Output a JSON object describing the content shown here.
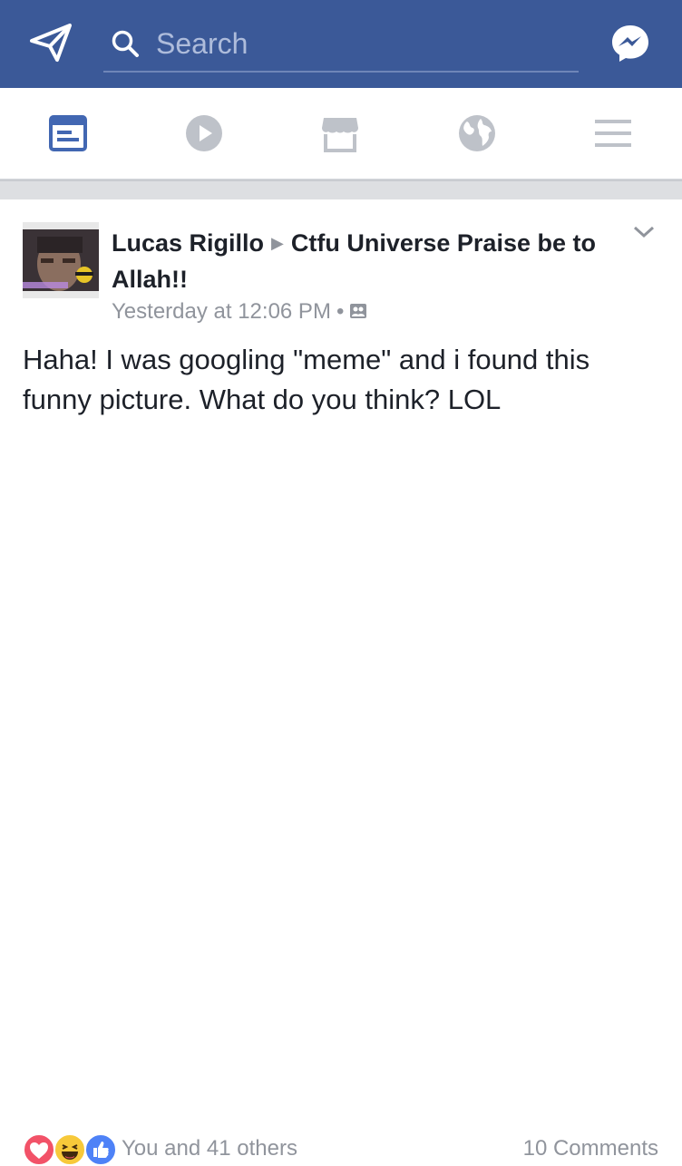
{
  "topbar": {
    "search_placeholder": "Search",
    "left_icon": "send-icon",
    "right_icon": "messenger-icon",
    "bg_color": "#3b5998"
  },
  "nav": {
    "tabs": [
      {
        "icon": "news-feed-icon",
        "active": true
      },
      {
        "icon": "video-play-icon",
        "active": false
      },
      {
        "icon": "marketplace-icon",
        "active": false
      },
      {
        "icon": "globe-icon",
        "active": false
      },
      {
        "icon": "menu-icon",
        "active": false
      }
    ],
    "active_color": "#4267b2",
    "inactive_color": "#bec2c9"
  },
  "post": {
    "author": "Lucas Rigillo",
    "target": "Ctfu Universe Praise be to Allah!!",
    "timestamp": "Yesterday at 12:06 PM",
    "separator": "•",
    "privacy_icon": "group-privacy-icon",
    "text": "Haha! I was googling \"meme\" and i found this funny picture. What do you think? LOL",
    "reactions": [
      "love",
      "haha",
      "like"
    ],
    "reactions_summary": "You and 41 others",
    "comments_count": "10 Comments"
  }
}
